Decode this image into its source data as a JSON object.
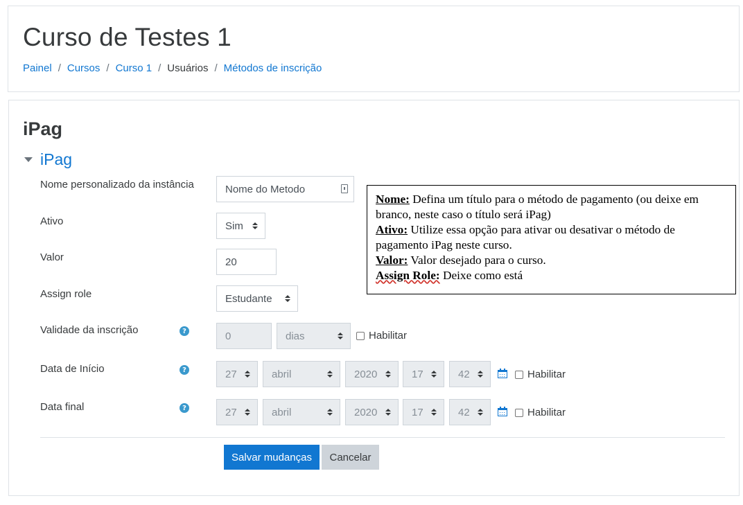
{
  "header": {
    "title": "Curso de Testes 1",
    "breadcrumb": [
      {
        "label": "Painel",
        "link": true
      },
      {
        "label": "Cursos",
        "link": true
      },
      {
        "label": "Curso 1",
        "link": true
      },
      {
        "label": "Usuários",
        "link": false
      },
      {
        "label": "Métodos de inscrição",
        "link": true
      }
    ],
    "separator": "/"
  },
  "form": {
    "page_heading": "iPag",
    "legend": "iPag",
    "fields": {
      "name": {
        "label": "Nome personalizado da instância",
        "value": "Nome do Metodo"
      },
      "active": {
        "label": "Ativo",
        "value": "Sim"
      },
      "cost": {
        "label": "Valor",
        "value": "20"
      },
      "role": {
        "label": "Assign role",
        "value": "Estudante"
      },
      "duration": {
        "label": "Validade da inscrição",
        "value": "0",
        "unit": "dias",
        "enable_label": "Habilitar"
      },
      "start_date": {
        "label": "Data de Início",
        "day": "27",
        "month": "abril",
        "year": "2020",
        "hour": "17",
        "minute": "42",
        "enable_label": "Habilitar"
      },
      "end_date": {
        "label": "Data final",
        "day": "27",
        "month": "abril",
        "year": "2020",
        "hour": "17",
        "minute": "42",
        "enable_label": "Habilitar"
      }
    },
    "buttons": {
      "save": "Salvar mudanças",
      "cancel": "Cancelar"
    },
    "help_icon_glyph": "?"
  },
  "note": {
    "lines": [
      {
        "key": "Nome:",
        "text": " Defina um título para o método de pagamento (ou deixe em branco, neste caso o título será iPag)"
      },
      {
        "key": "Ativo:",
        "text": " Utilize essa opção para ativar ou desativar o método de pagamento iPag neste curso."
      },
      {
        "key": "Valor:",
        "text": " Valor desejado para o curso."
      },
      {
        "key": "Assign Role:",
        "text": " Deixe como está"
      }
    ]
  },
  "colors": {
    "link": "#1177d1",
    "primary_button": "#1177d1",
    "secondary_button": "#ced4da",
    "help_icon": "#3a99cd"
  }
}
